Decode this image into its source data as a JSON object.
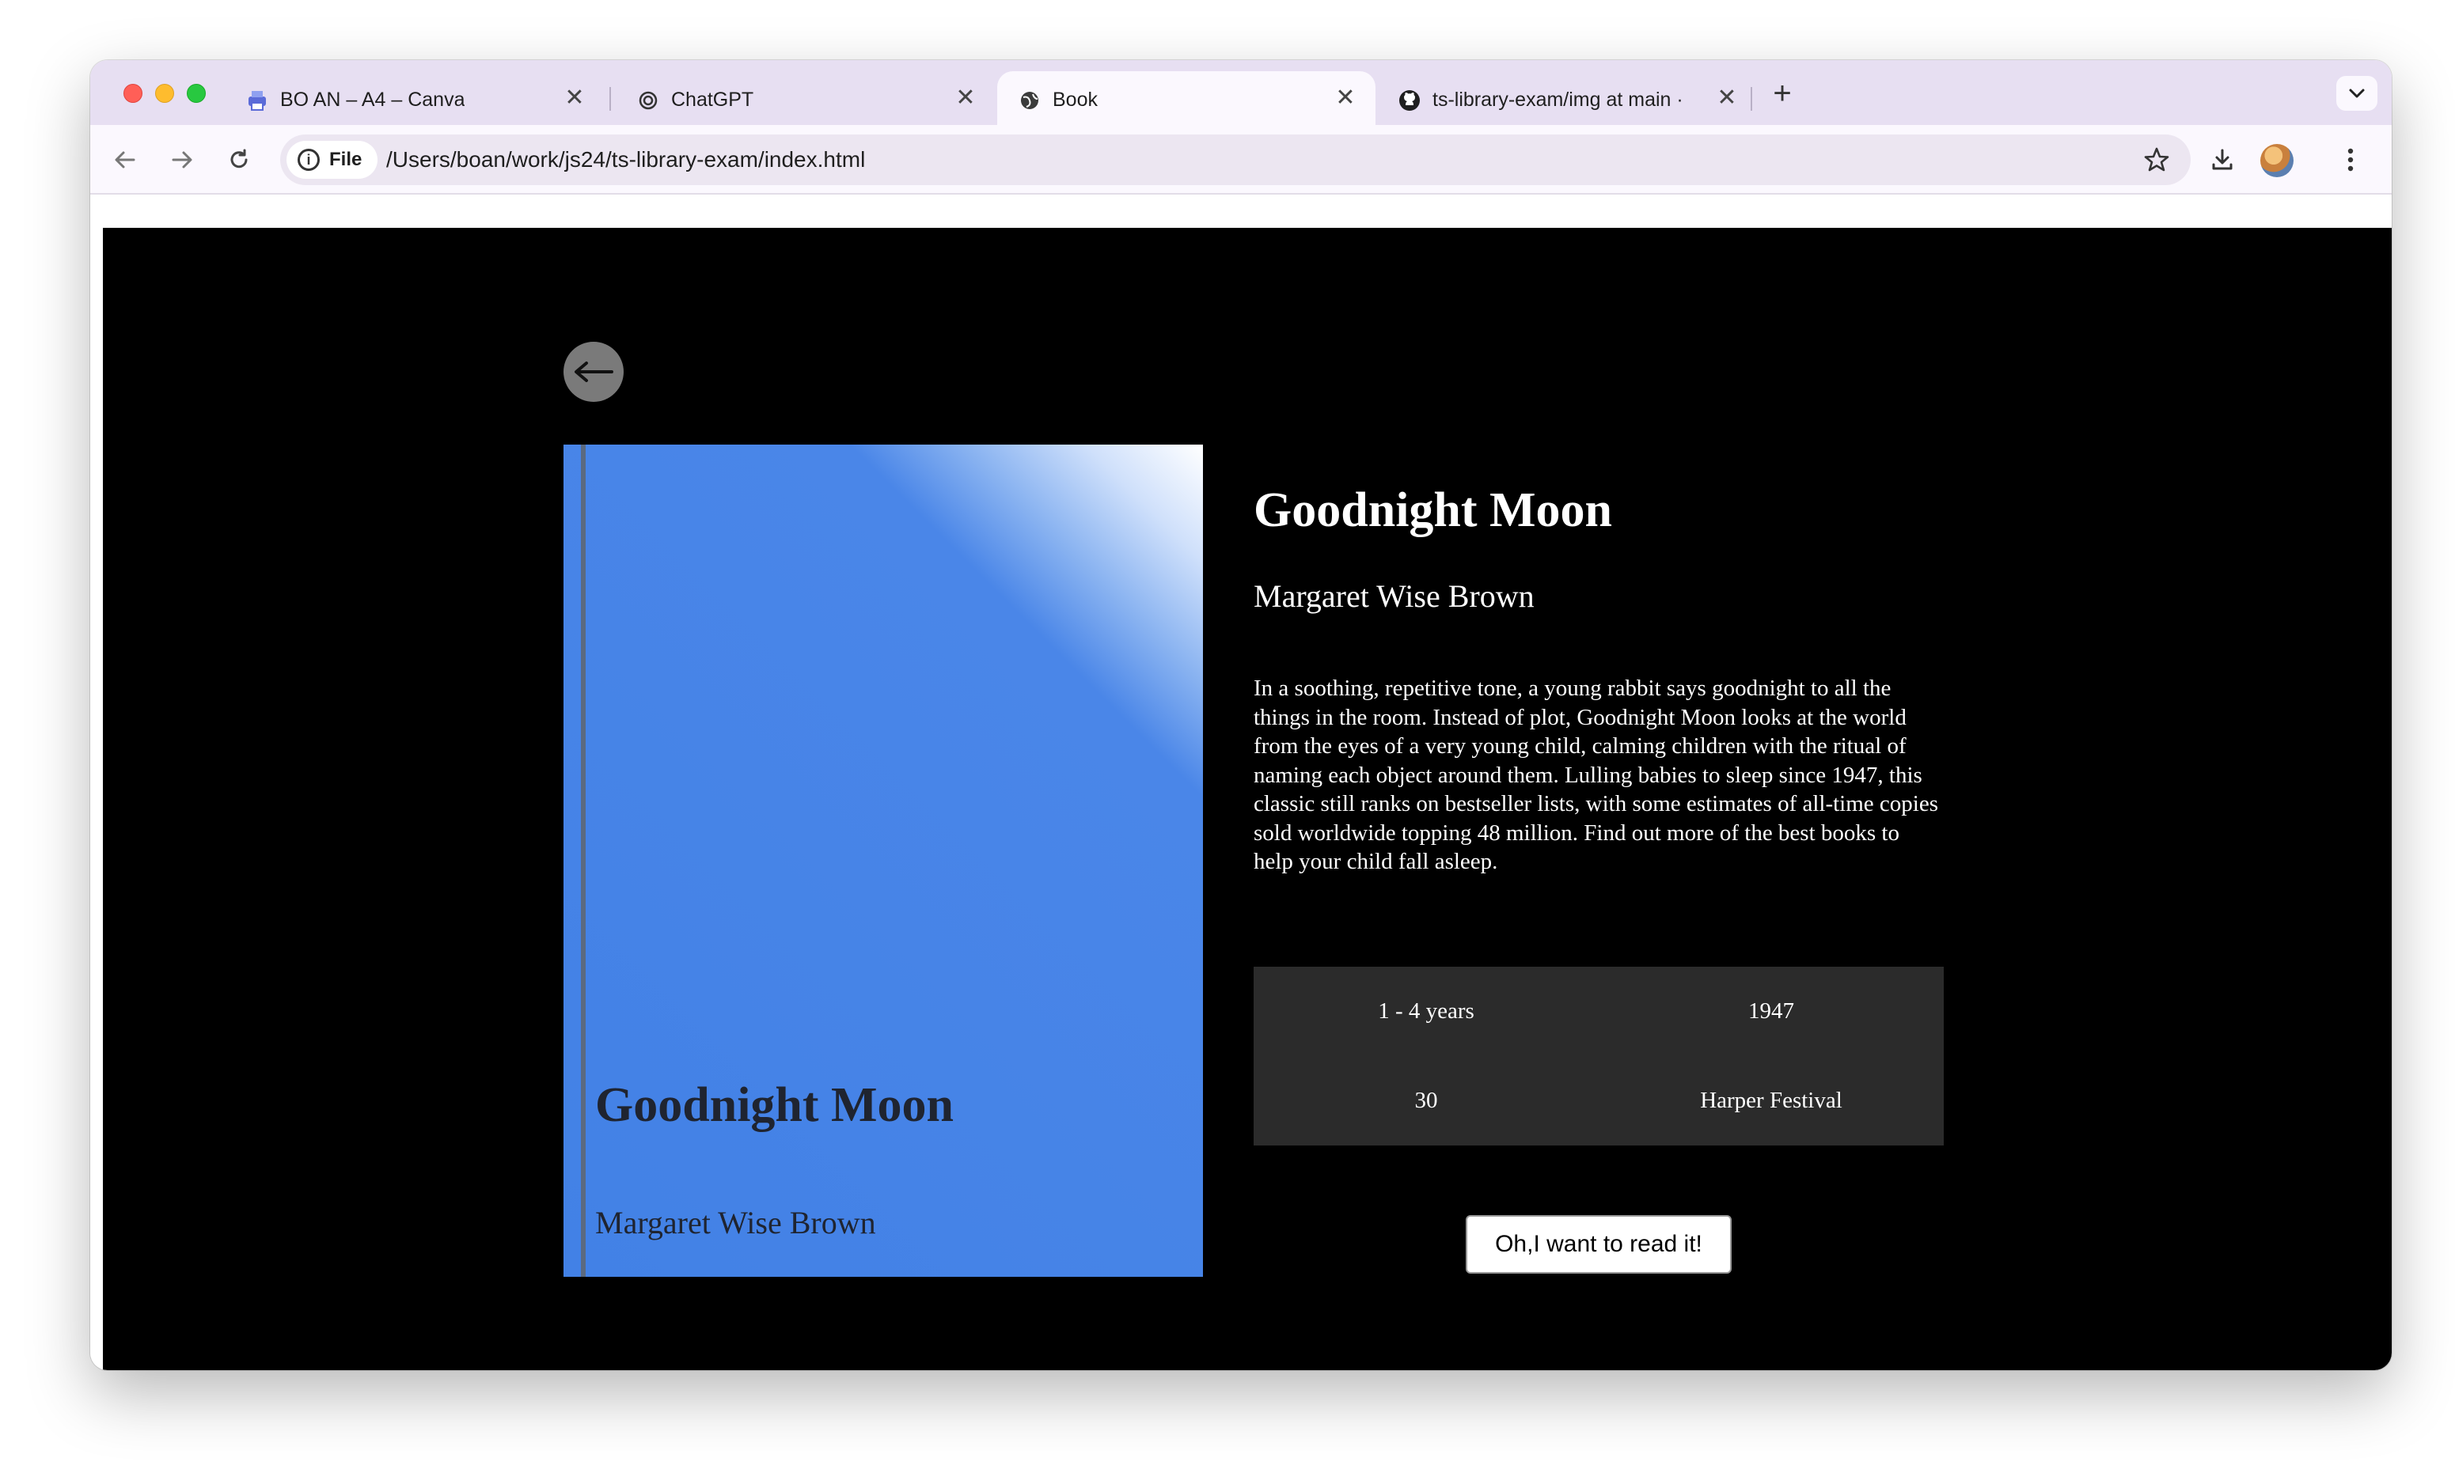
{
  "browser": {
    "tabs": [
      {
        "title": "BO AN – A4 – Canva",
        "favicon": "canva-printer-icon",
        "active": false
      },
      {
        "title": "ChatGPT",
        "favicon": "chatgpt-icon",
        "active": false
      },
      {
        "title": "Book",
        "favicon": "globe-icon",
        "active": true
      },
      {
        "title": "ts-library-exam/img at main ·",
        "favicon": "github-icon",
        "active": false
      }
    ],
    "close_glyph": "✕",
    "new_tab_glyph": "+",
    "tab_menu_glyph": "⌄",
    "omnibox": {
      "chip_label": "File",
      "url": "/Users/boan/work/js24/ts-library-exam/index.html"
    }
  },
  "page": {
    "back_icon": "arrow-left-icon",
    "cover": {
      "title": "Goodnight Moon",
      "author": "Margaret Wise Brown",
      "color": "#4281e6"
    },
    "book": {
      "title": "Goodnight Moon",
      "author": "Margaret Wise Brown",
      "description": "In a soothing, repetitive tone, a young rabbit says goodnight to all the things in the room. Instead of plot, Goodnight Moon looks at the world from the eyes of a very young child, calming children with the ritual of naming each object around them. Lulling babies to sleep since 1947, this classic still ranks on bestseller lists, with some estimates of all-time copies sold worldwide topping 48 million. Find out more of the best books to help your child fall asleep.",
      "info": [
        [
          "1 - 4 years",
          "1947"
        ],
        [
          "30",
          "Harper Festival"
        ]
      ]
    },
    "read_button": "Oh,I want to read it!"
  }
}
